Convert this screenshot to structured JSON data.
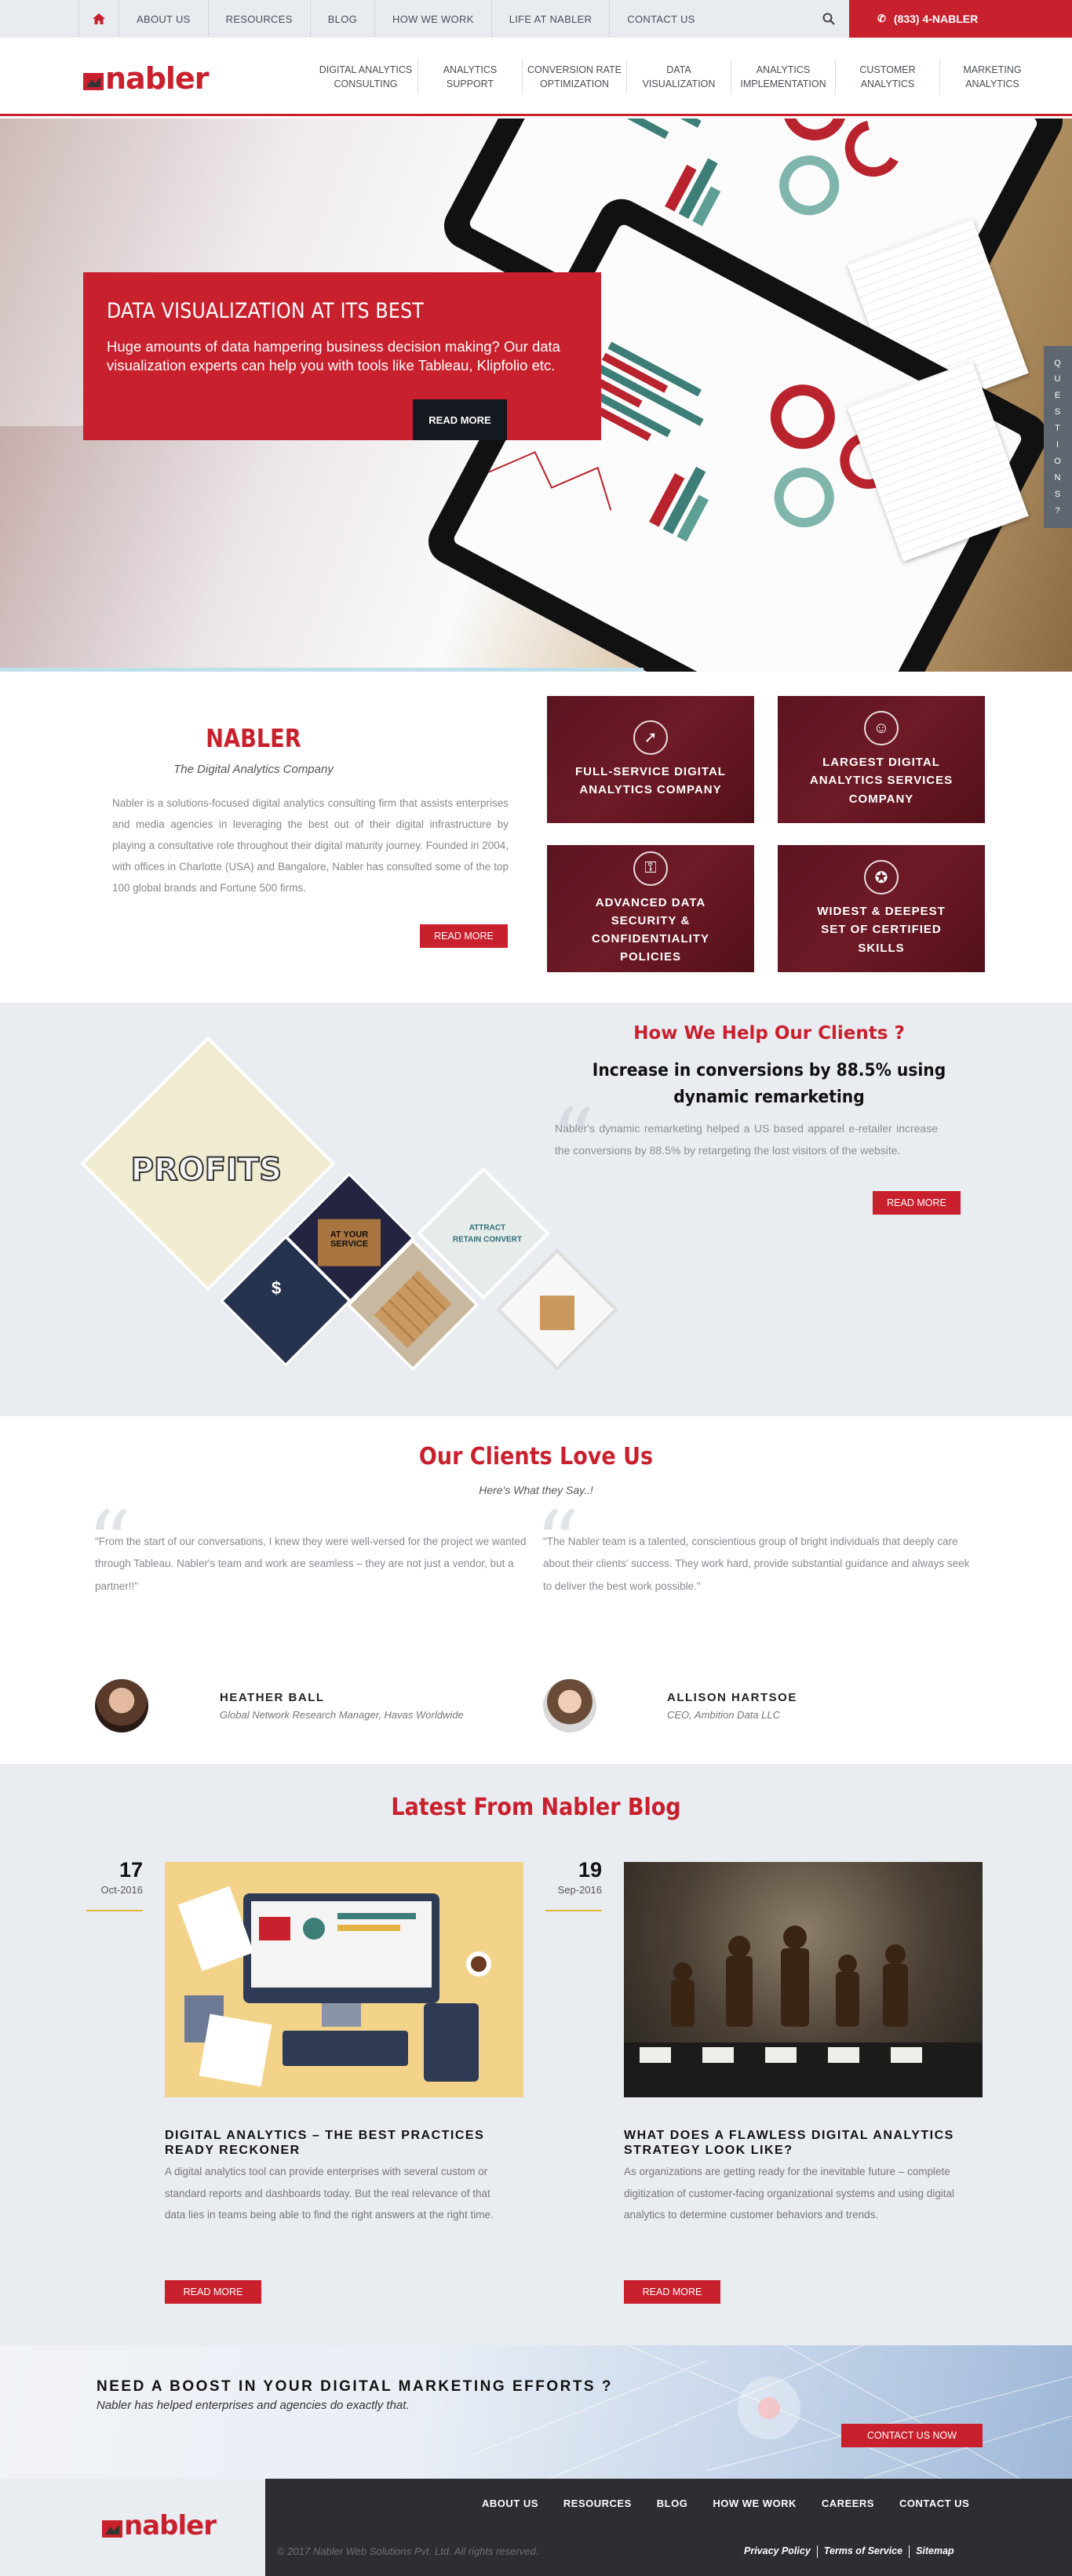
{
  "topbar": {
    "nav": [
      "ABOUT US",
      "RESOURCES",
      "BLOG",
      "HOW WE WORK",
      "LIFE AT NABLER",
      "CONTACT US"
    ],
    "phone": "(833) 4-NABLER"
  },
  "brand": {
    "logo_text": "nabler",
    "accent": "#c8202d"
  },
  "main_nav": [
    "DIGITAL ANALYTICS CONSULTING",
    "ANALYTICS SUPPORT",
    "CONVERSION RATE OPTIMIZATION",
    "DATA VISUALIZATION",
    "ANALYTICS IMPLEMENTATION",
    "CUSTOMER ANALYTICS",
    "MARKETING ANALYTICS"
  ],
  "hero": {
    "title": "DATA VISUALIZATION AT ITS BEST",
    "text": "Huge amounts of data hampering business decision making? Our data visualization experts can help you with tools like Tableau, Klipfolio etc.",
    "button": "READ MORE",
    "side_tab": [
      "Q",
      "U",
      "E",
      "S",
      "T",
      "I",
      "O",
      "N",
      "S",
      "?"
    ]
  },
  "about": {
    "title": "NABLER",
    "subtitle": "The Digital Analytics Company",
    "description": "Nabler is a solutions-focused digital analytics consulting firm that assists enterprises and media agencies in leveraging the best out of their digital infrastructure by playing a consultative role throughout their digital maturity journey. Founded in 2004, with offices in Charlotte (USA) and Bangalore, Nabler has consulted some of the top 100 global brands and Fortune 500 firms.",
    "button": "READ MORE",
    "tiles": [
      {
        "label": "FULL-SERVICE DIGITAL ANALYTICS COMPANY",
        "icon": "rocket-icon"
      },
      {
        "label": "LARGEST DIGITAL ANALYTICS SERVICES COMPANY",
        "icon": "team-icon"
      },
      {
        "label": "ADVANCED DATA SECURITY & CONFIDENTIALITY POLICIES",
        "icon": "security-icon"
      },
      {
        "label": "WIDEST & DEEPEST SET OF CERTIFIED SKILLS",
        "icon": "certificate-icon"
      }
    ]
  },
  "help": {
    "heading": "How We Help Our Clients ?",
    "subheading": "Increase in conversions by 88.5% using dynamic remarketing",
    "quote": "Nabler's dynamic remarketing helped a US based apparel e-retailer increase the conversions by 88.5% by retargeting the lost visitors of the website.",
    "button": "READ MORE",
    "images": {
      "profits": "PROFITS",
      "service": "AT YOUR SERVICE",
      "attract": "ATTRACT",
      "retain": "RETAIN",
      "convert": "CONVERT"
    }
  },
  "clients": {
    "title": "Our Clients Love Us",
    "subtitle": "Here's What they Say..!",
    "testimonials": [
      {
        "text": "\"From the start of our conversations, I knew they were well-versed for the project we wanted through Tableau. Nabler's team and work are seamless – they are not just a vendor, but a partner!!\"",
        "name": "HEATHER BALL",
        "role": "Global Network Research Manager, Havas Worldwide"
      },
      {
        "text": "\"The Nabler team is a talented, conscientious group of bright individuals that deeply care about their clients' success. They work hard, provide substantial guidance and always seek to deliver the best work possible.\"",
        "name": "ALLISON HARTSOE",
        "role": "CEO, Ambition Data LLC"
      }
    ]
  },
  "blog": {
    "title": "Latest From Nabler Blog",
    "posts": [
      {
        "day": "17",
        "month": "Oct-2016",
        "title": "DIGITAL ANALYTICS – THE BEST PRACTICES READY RECKONER",
        "excerpt": "A digital analytics tool can provide enterprises with several custom or standard reports and dashboards today. But the real relevance of that data lies in teams being able to find the right answers at the right time.",
        "button": "READ MORE"
      },
      {
        "day": "19",
        "month": "Sep-2016",
        "title": "WHAT DOES A FLAWLESS DIGITAL ANALYTICS STRATEGY LOOK LIKE?",
        "excerpt": "As organizations are getting ready for the inevitable future – complete digitization of customer-facing organizational systems and using digital analytics to determine customer behaviors and trends.",
        "button": "READ MORE"
      }
    ]
  },
  "cta": {
    "heading": "NEED A BOOST IN YOUR DIGITAL MARKETING EFFORTS ?",
    "text": "Nabler has helped enterprises and agencies do exactly that.",
    "button": "CONTACT US NOW"
  },
  "footer": {
    "nav": [
      "ABOUT US",
      "RESOURCES",
      "BLOG",
      "HOW WE WORK",
      "CAREERS",
      "CONTACT US"
    ],
    "copyright": "© 2017 Nabler Web Solutions Pvt. Ltd. All rights reserved.",
    "legal": [
      "Privacy Policy",
      "Terms of Service",
      "Sitemap"
    ]
  }
}
